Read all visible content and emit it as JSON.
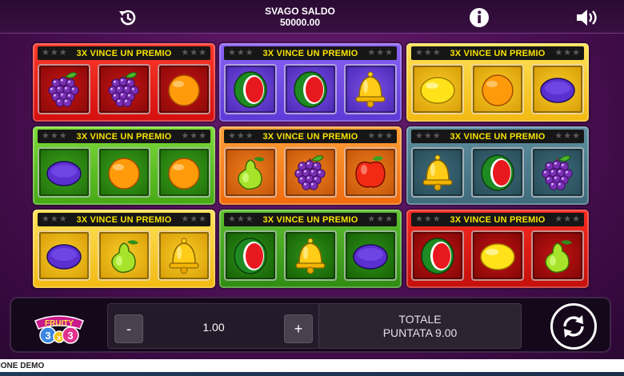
{
  "header": {
    "balance_label": "SVAGO SALDO",
    "balance_value": "50000.00",
    "icons": [
      "history-icon",
      "info-icon",
      "sound-icon"
    ]
  },
  "cards": [
    {
      "title": "3X VINCE UN PREMIO",
      "color": "red",
      "symbols": [
        "grapes",
        "grapes",
        "orange"
      ]
    },
    {
      "title": "3X VINCE UN PREMIO",
      "color": "purple",
      "symbols": [
        "watermelon",
        "watermelon",
        "bell"
      ]
    },
    {
      "title": "3X VINCE UN PREMIO",
      "color": "yellow",
      "symbols": [
        "lemon",
        "orange",
        "plum"
      ]
    },
    {
      "title": "3X VINCE UN PREMIO",
      "color": "green",
      "symbols": [
        "plum",
        "orange",
        "orange"
      ]
    },
    {
      "title": "3X VINCE UN PREMIO",
      "color": "orange",
      "symbols": [
        "pear",
        "grapes",
        "apple"
      ]
    },
    {
      "title": "3X VINCE UN PREMIO",
      "color": "teal",
      "symbols": [
        "bell",
        "watermelon",
        "grapes"
      ]
    },
    {
      "title": "3X VINCE UN PREMIO",
      "color": "yellow",
      "symbols": [
        "plum",
        "pear",
        "bell"
      ]
    },
    {
      "title": "3X VINCE UN PREMIO",
      "color": "green",
      "symbols": [
        "watermelon",
        "bell",
        "plum"
      ]
    },
    {
      "title": "3X VINCE UN PREMIO",
      "color": "red",
      "symbols": [
        "watermelon",
        "lemon",
        "pear"
      ]
    }
  ],
  "controls": {
    "logo_text": "FRUITY 3x3",
    "minus_label": "-",
    "stake_value": "1.00",
    "plus_label": "+",
    "total_label": "TOTALE",
    "total_value": "PUNTATA 9.00",
    "spin_icon": "refresh-icon"
  },
  "footer": {
    "label": "IONE DEMO"
  }
}
